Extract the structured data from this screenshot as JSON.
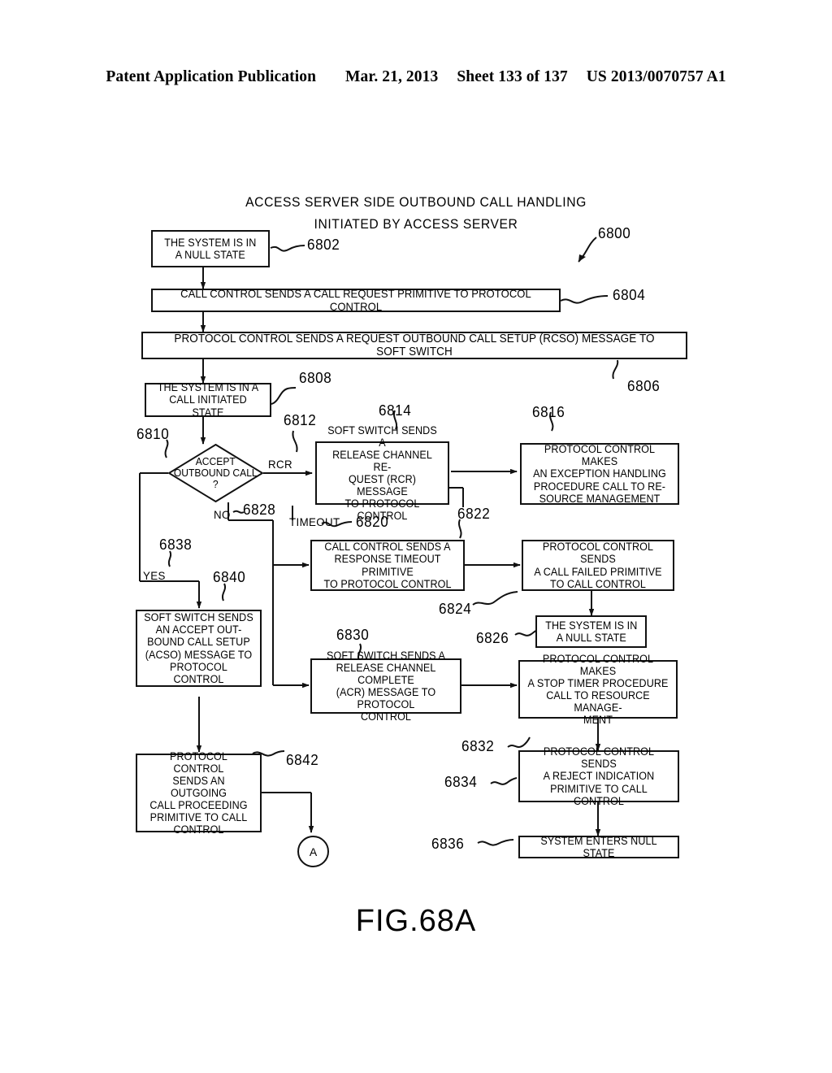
{
  "header": {
    "publication": "Patent Application Publication",
    "date": "Mar. 21, 2013",
    "sheet": "Sheet 133 of 137",
    "patent_number": "US 2013/0070757 A1"
  },
  "figure": {
    "caption": "FIG.68A",
    "title_line1": "ACCESS SERVER SIDE OUTBOUND CALL HANDLING",
    "title_line2": "INITIATED BY ACCESS SERVER",
    "diagram_ref": "6800",
    "connector_a": "A"
  },
  "nodes": {
    "n6802": "THE SYSTEM IS IN\nA NULL STATE",
    "n6804": "CALL CONTROL SENDS A CALL REQUEST PRIMITIVE TO PROTOCOL CONTROL",
    "n6806": "PROTOCOL CONTROL SENDS A REQUEST OUTBOUND CALL SETUP (RCSO) MESSAGE TO SOFT SWITCH",
    "n6808": "THE SYSTEM IS IN A\nCALL INITIATED STATE",
    "n6810": "ACCEPT\nOUTBOUND CALL\n?",
    "n6814": "SOFT SWITCH SENDS A\nRELEASE CHANNEL RE-\nQUEST (RCR) MESSAGE\nTO PROTOCOL CONTROL",
    "n6816": "PROTOCOL CONTROL MAKES\nAN EXCEPTION HANDLING\nPROCEDURE CALL TO RE-\nSOURCE MANAGEMENT",
    "n6822": "CALL CONTROL SENDS A\nRESPONSE TIMEOUT PRIMITIVE\nTO PROTOCOL CONTROL",
    "n6824": "PROTOCOL CONTROL SENDS\nA CALL FAILED PRIMITIVE\nTO CALL CONTROL",
    "n6826": "THE SYSTEM IS IN\nA NULL STATE",
    "n6830": "SOFT SWITCH SENDS A\nRELEASE CHANNEL COMPLETE\n(ACR) MESSAGE TO PROTOCOL\nCONTROL",
    "n6832": "PROTOCOL CONTROL MAKES\nA STOP TIMER PROCEDURE\nCALL TO RESOURCE MANAGE-\nMENT",
    "n6834": "PROTOCOL CONTROL SENDS\nA REJECT INDICATION\nPRIMITIVE TO CALL CONTROL",
    "n6836": "SYSTEM ENTERS NULL STATE",
    "n6840": "SOFT SWITCH SENDS\nAN ACCEPT OUT-\nBOUND CALL SETUP\n(ACSO) MESSAGE TO\nPROTOCOL CONTROL",
    "n6842": "PROTOCOL CONTROL\nSENDS AN OUTGOING\nCALL PROCEEDING\nPRIMITIVE TO CALL\nCONTROL"
  },
  "refs": {
    "r6800": "6800",
    "r6802": "6802",
    "r6804": "6804",
    "r6806": "6806",
    "r6808": "6808",
    "r6810": "6810",
    "r6812": "6812",
    "r6814": "6814",
    "r6816": "6816",
    "r6820": "6820",
    "r6822": "6822",
    "r6824": "6824",
    "r6826": "6826",
    "r6828": "6828",
    "r6830": "6830",
    "r6832": "6832",
    "r6834": "6834",
    "r6836": "6836",
    "r6838": "6838",
    "r6840": "6840",
    "r6842": "6842"
  },
  "edge_labels": {
    "rcr": "RCR",
    "timeout": "TIMEOUT",
    "no": "NO",
    "yes": "YES"
  },
  "colors": {
    "ink": "#111111",
    "paper": "#ffffff"
  }
}
